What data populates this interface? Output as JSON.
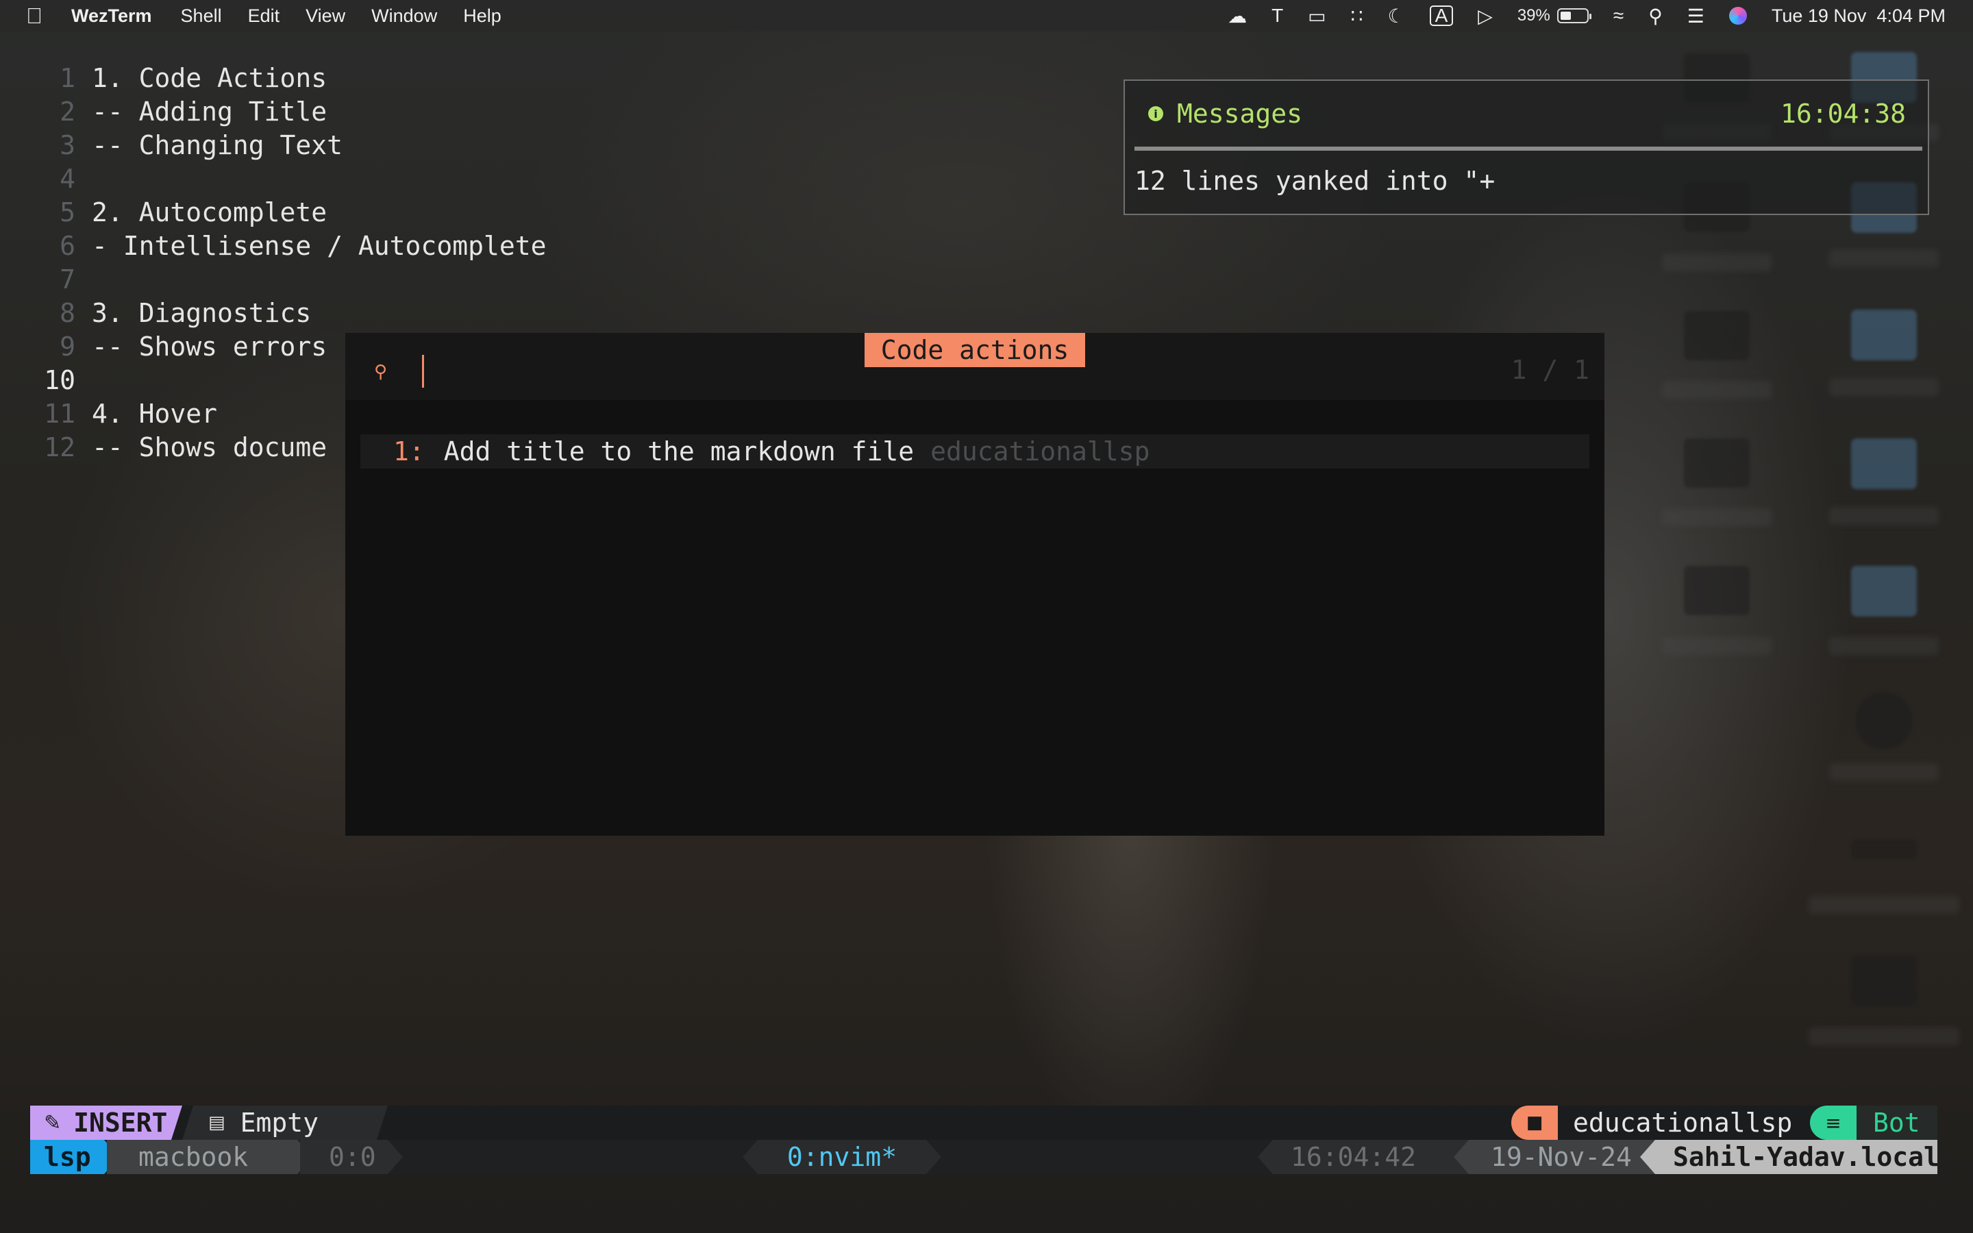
{
  "menubar": {
    "app_name": "WezTerm",
    "menus": [
      "Shell",
      "Edit",
      "View",
      "Window",
      "Help"
    ],
    "tray": {
      "t_label": "T",
      "keyboard_label": "A",
      "battery_percent": "39%",
      "battery_level": 0.39,
      "datetime": "Tue 19 Nov  4:04 PM"
    }
  },
  "editor": {
    "lines": [
      {
        "num": "1",
        "text": "1. Code Actions"
      },
      {
        "num": "2",
        "text": "-- Adding Title"
      },
      {
        "num": "3",
        "text": "-- Changing Text"
      },
      {
        "num": "4",
        "text": ""
      },
      {
        "num": "5",
        "text": "2. Autocomplete"
      },
      {
        "num": "6",
        "text": "- Intellisense / Autocomplete"
      },
      {
        "num": "7",
        "text": ""
      },
      {
        "num": "8",
        "text": "3. Diagnostics"
      },
      {
        "num": "9",
        "text": "-- Shows errors"
      },
      {
        "num": "10",
        "text": ""
      },
      {
        "num": "11",
        "text": "4. Hover"
      },
      {
        "num": "12",
        "text": "-- Shows docume"
      }
    ],
    "current_line": "10"
  },
  "messages": {
    "title": "Messages",
    "time": "16:04:38",
    "body": "12 lines yanked into \"+",
    "progress": 1.0
  },
  "code_actions": {
    "title": "Code actions",
    "query": "",
    "counter": "1 / 1",
    "items": [
      {
        "index": "1:",
        "label": "Add title to the markdown file",
        "source": "educationallsp"
      }
    ]
  },
  "statusline": {
    "mode": "INSERT",
    "file_status": "Empty",
    "project": "educationallsp",
    "position": "Bot"
  },
  "tmux": {
    "session": "lsp",
    "host": "macbook",
    "pane": "0:0",
    "window": "0:nvim*",
    "time": "16:04:42",
    "date": "19-Nov-24",
    "hostname": "Sahil-Yadav.local"
  },
  "colors": {
    "accent_orange": "#f48a66",
    "message_green": "#b4e26b",
    "insert_purple": "#c69ff3",
    "tmux_blue": "#1aa0e6",
    "window_cyan": "#52c7f2",
    "position_green": "#2fd397"
  }
}
